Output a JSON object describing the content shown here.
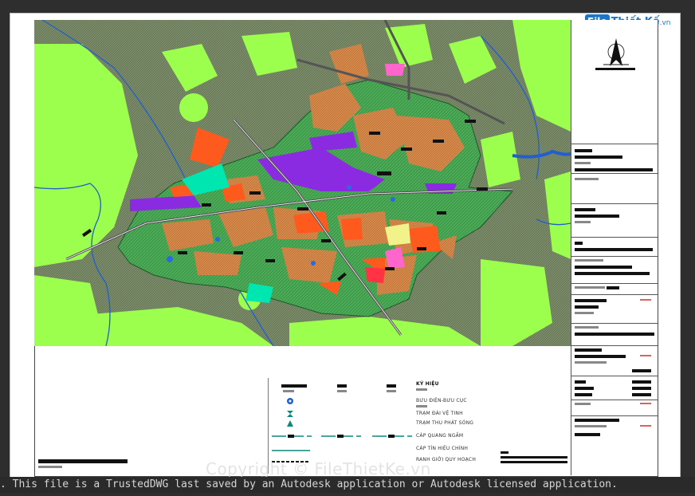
{
  "logo": {
    "mark": "File",
    "name": "Thiết Kế",
    "tld": ".vn"
  },
  "legend": {
    "title": "KÝ HIỆU",
    "items": [
      "BƯU ĐIỆN-BƯU CỤC",
      "TRẠM ĐÀI VỆ TINH",
      "TRẠM THU PHÁT SÓNG",
      "CÁP QUANG NGẦM",
      "CÁP TÍN HIỆU CHÍNH",
      "RANH GIỚI QUY HOẠCH"
    ]
  },
  "watermark": "Copyright © FileThietKe.vn",
  "status_message": ". This file is a TrustedDWG last saved by an Autodesk application or Autodesk licensed application.",
  "colors": {
    "background": "#2e2e2e",
    "sheet": "#ffffff",
    "park_green": "#9cff4d",
    "planning_area": "#2e8b57",
    "residential": "#d08040",
    "commercial": "#ff5a1e",
    "industrial": "#8a2be2",
    "water": "#1f5fd0",
    "cyan_zone": "#00e6b0",
    "pink": "#ff66cc",
    "road": "#555555"
  },
  "icons": [
    "post-office-icon",
    "satellite-station-icon",
    "transmitter-icon",
    "north-arrow-icon"
  ]
}
